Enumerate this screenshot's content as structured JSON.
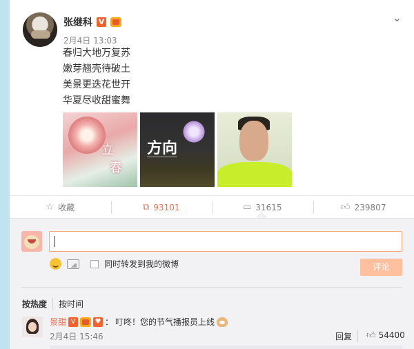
{
  "post": {
    "author": "张继科",
    "time": "2月4日 13:03",
    "lines": [
      "春归大地万复苏",
      "嫩芽翘壳待破土",
      "美景更迭花世开",
      "华夏尽收甜蜜舞"
    ],
    "images": [
      {
        "text1": "立",
        "text2": "春"
      },
      {
        "text1": "方向"
      },
      {}
    ],
    "menu_icon": "chevron-down-icon"
  },
  "actions": {
    "favorite": {
      "label": "收藏",
      "icon": "star-icon"
    },
    "repost": {
      "count": "93101",
      "icon": "repost-icon"
    },
    "comment": {
      "count": "31615",
      "icon": "comment-icon"
    },
    "like": {
      "count": "239807",
      "icon": "thumbs-up-icon"
    }
  },
  "composer": {
    "input_value": "",
    "also_repost_label": "同时转发到我的微博",
    "submit_label": "评论"
  },
  "sort": {
    "hot": "按热度",
    "time": "按时间"
  },
  "comments": [
    {
      "user": "景甜",
      "text": "叮咚！您的节气播报员上线",
      "time": "2月4日 15:46",
      "reply_label": "回复",
      "likes": "54400"
    }
  ],
  "colors": {
    "accent": "#eb7350",
    "vip": "#f2612e",
    "leftbar": "#bfe3ef"
  }
}
